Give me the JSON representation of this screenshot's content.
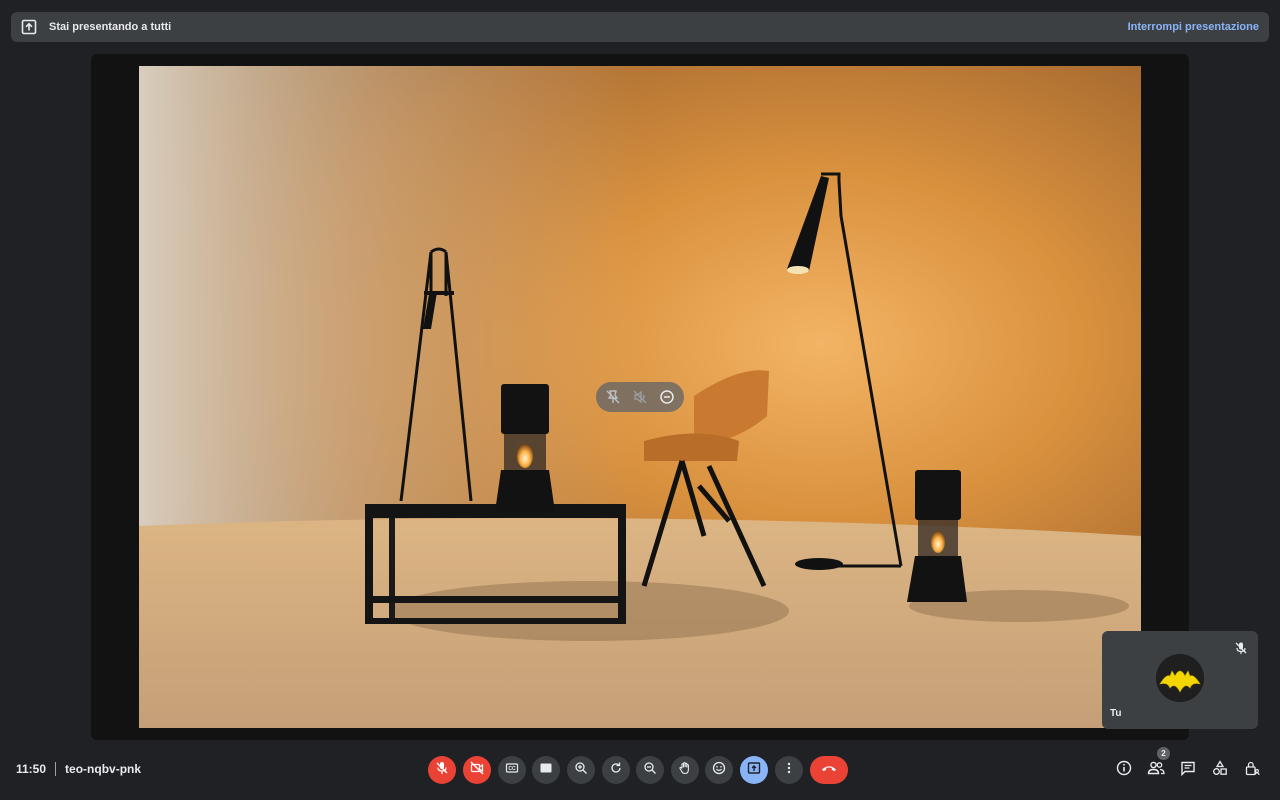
{
  "banner": {
    "text": "Stai presentando a tutti",
    "stop_label": "Interrompi presentazione",
    "icon": "present-screen-icon"
  },
  "self_tile": {
    "name": "Tu",
    "mic_state": "muted",
    "avatar_icon": "bat-logo-icon"
  },
  "meeting": {
    "time": "11:50",
    "code": "teo-nqbv-pnk"
  },
  "controls": [
    {
      "name": "mic-off-button",
      "icon": "mic-off-icon",
      "state": "off"
    },
    {
      "name": "camera-off-button",
      "icon": "camera-off-icon",
      "state": "off"
    },
    {
      "name": "captions-button",
      "icon": "captions-icon"
    },
    {
      "name": "layout-button",
      "icon": "layout-icon"
    },
    {
      "name": "zoom-in-button",
      "icon": "zoom-in-icon"
    },
    {
      "name": "rotate-button",
      "icon": "rotate-icon"
    },
    {
      "name": "zoom-out-button",
      "icon": "zoom-out-icon"
    },
    {
      "name": "raise-hand-button",
      "icon": "hand-icon"
    },
    {
      "name": "emoji-button",
      "icon": "emoji-icon"
    },
    {
      "name": "present-button",
      "icon": "present-icon",
      "state": "active"
    },
    {
      "name": "more-options-button",
      "icon": "more-vert-icon"
    },
    {
      "name": "leave-call-button",
      "icon": "call-end-icon"
    }
  ],
  "right_controls": {
    "info_icon": "info-icon",
    "people_icon": "people-icon",
    "people_count": "2",
    "chat_icon": "chat-icon",
    "activities_icon": "activities-icon",
    "host_controls_icon": "lock-person-icon"
  },
  "colors": {
    "background": "#202124",
    "danger": "#ea4335",
    "accent": "#8ab4f8",
    "surface": "#3c4043"
  }
}
